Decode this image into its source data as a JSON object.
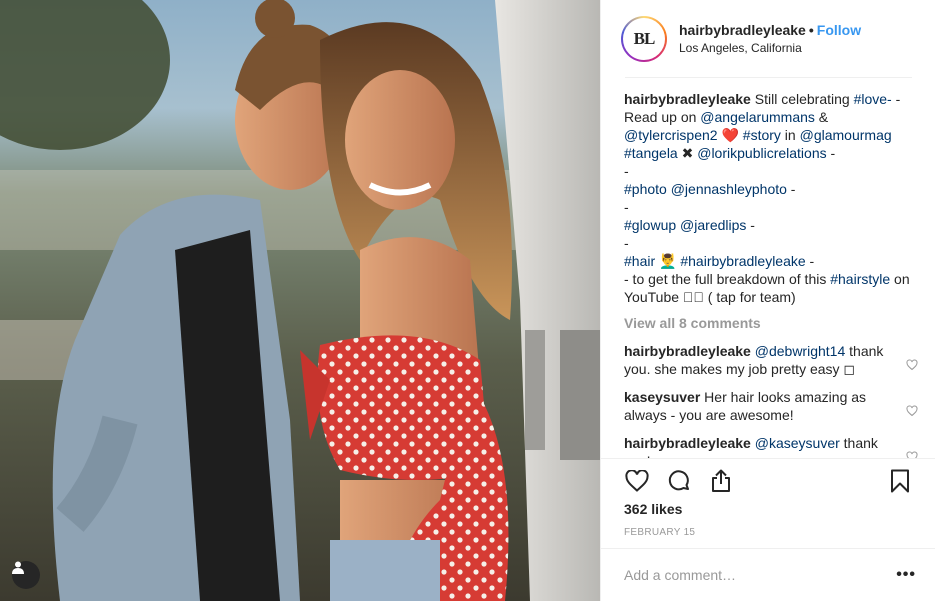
{
  "post": {
    "username": "hairbybradleyleake",
    "avatar_initials": "BL",
    "follow_label": "Follow",
    "location": "Los Angeles, California",
    "caption": [
      {
        "t": "u",
        "v": "hairbybradleyleake"
      },
      {
        "t": "s",
        "v": " Still celebrating "
      },
      {
        "t": "h",
        "v": "#love-"
      },
      {
        "t": "s",
        "v": " - Read up on "
      },
      {
        "t": "h",
        "v": "@angelarummans"
      },
      {
        "t": "s",
        "v": " & "
      },
      {
        "t": "h",
        "v": "@tylercrispen2"
      },
      {
        "t": "s",
        "v": " ❤️ "
      },
      {
        "t": "h",
        "v": "#story"
      },
      {
        "t": "s",
        "v": " in "
      },
      {
        "t": "h",
        "v": "@glamourmag"
      },
      {
        "t": "br"
      },
      {
        "t": "h",
        "v": "#tangela"
      },
      {
        "t": "s",
        "v": " ✖ "
      },
      {
        "t": "h",
        "v": "@lorikpublicrelations"
      },
      {
        "t": "s",
        "v": " -"
      },
      {
        "t": "br"
      },
      {
        "t": "s",
        "v": "-"
      },
      {
        "t": "br"
      },
      {
        "t": "h",
        "v": "#photo"
      },
      {
        "t": "s",
        "v": " "
      },
      {
        "t": "h",
        "v": "@jennashleyphoto"
      },
      {
        "t": "s",
        "v": " -"
      },
      {
        "t": "br"
      },
      {
        "t": "s",
        "v": "-"
      },
      {
        "t": "br"
      },
      {
        "t": "h",
        "v": "#glowup"
      },
      {
        "t": "s",
        "v": " "
      },
      {
        "t": "h",
        "v": "@jaredlips"
      },
      {
        "t": "s",
        "v": " -"
      },
      {
        "t": "br"
      },
      {
        "t": "s",
        "v": "-"
      },
      {
        "t": "br"
      },
      {
        "t": "h",
        "v": "#hair"
      },
      {
        "t": "s",
        "v": " 💆‍♂️ "
      },
      {
        "t": "h",
        "v": "#hairbybradleyleake"
      },
      {
        "t": "s",
        "v": " -"
      },
      {
        "t": "br"
      },
      {
        "t": "s",
        "v": "- to get the full breakdown of this "
      },
      {
        "t": "h",
        "v": "#hairstyle"
      },
      {
        "t": "s",
        "v": " on YouTube ◻🏼 ( tap for team)"
      }
    ],
    "view_all_comments": "View all 8 comments",
    "comments": [
      {
        "username": "hairbybradleyleake",
        "mention": "@debwright14",
        "text": " thank you. she makes my job pretty easy ◻"
      },
      {
        "username": "kaseysuver",
        "mention": "",
        "text": " Her hair looks amazing as always - you are awesome!"
      },
      {
        "username": "hairbybradleyleake",
        "mention": "@kaseysuver",
        "text": " thank you!"
      }
    ],
    "likes": "362 likes",
    "date": "February 15",
    "add_comment_placeholder": "Add a comment…",
    "more_options": "•••"
  },
  "icons": {
    "like": "heart-icon",
    "comment": "comment-icon",
    "share": "share-icon",
    "save": "bookmark-icon",
    "tags": "user-tag-icon",
    "comment_like": "heart-icon"
  },
  "colors": {
    "link": "#003569",
    "follow": "#3897f0",
    "muted": "#999999",
    "border": "#efefef"
  }
}
